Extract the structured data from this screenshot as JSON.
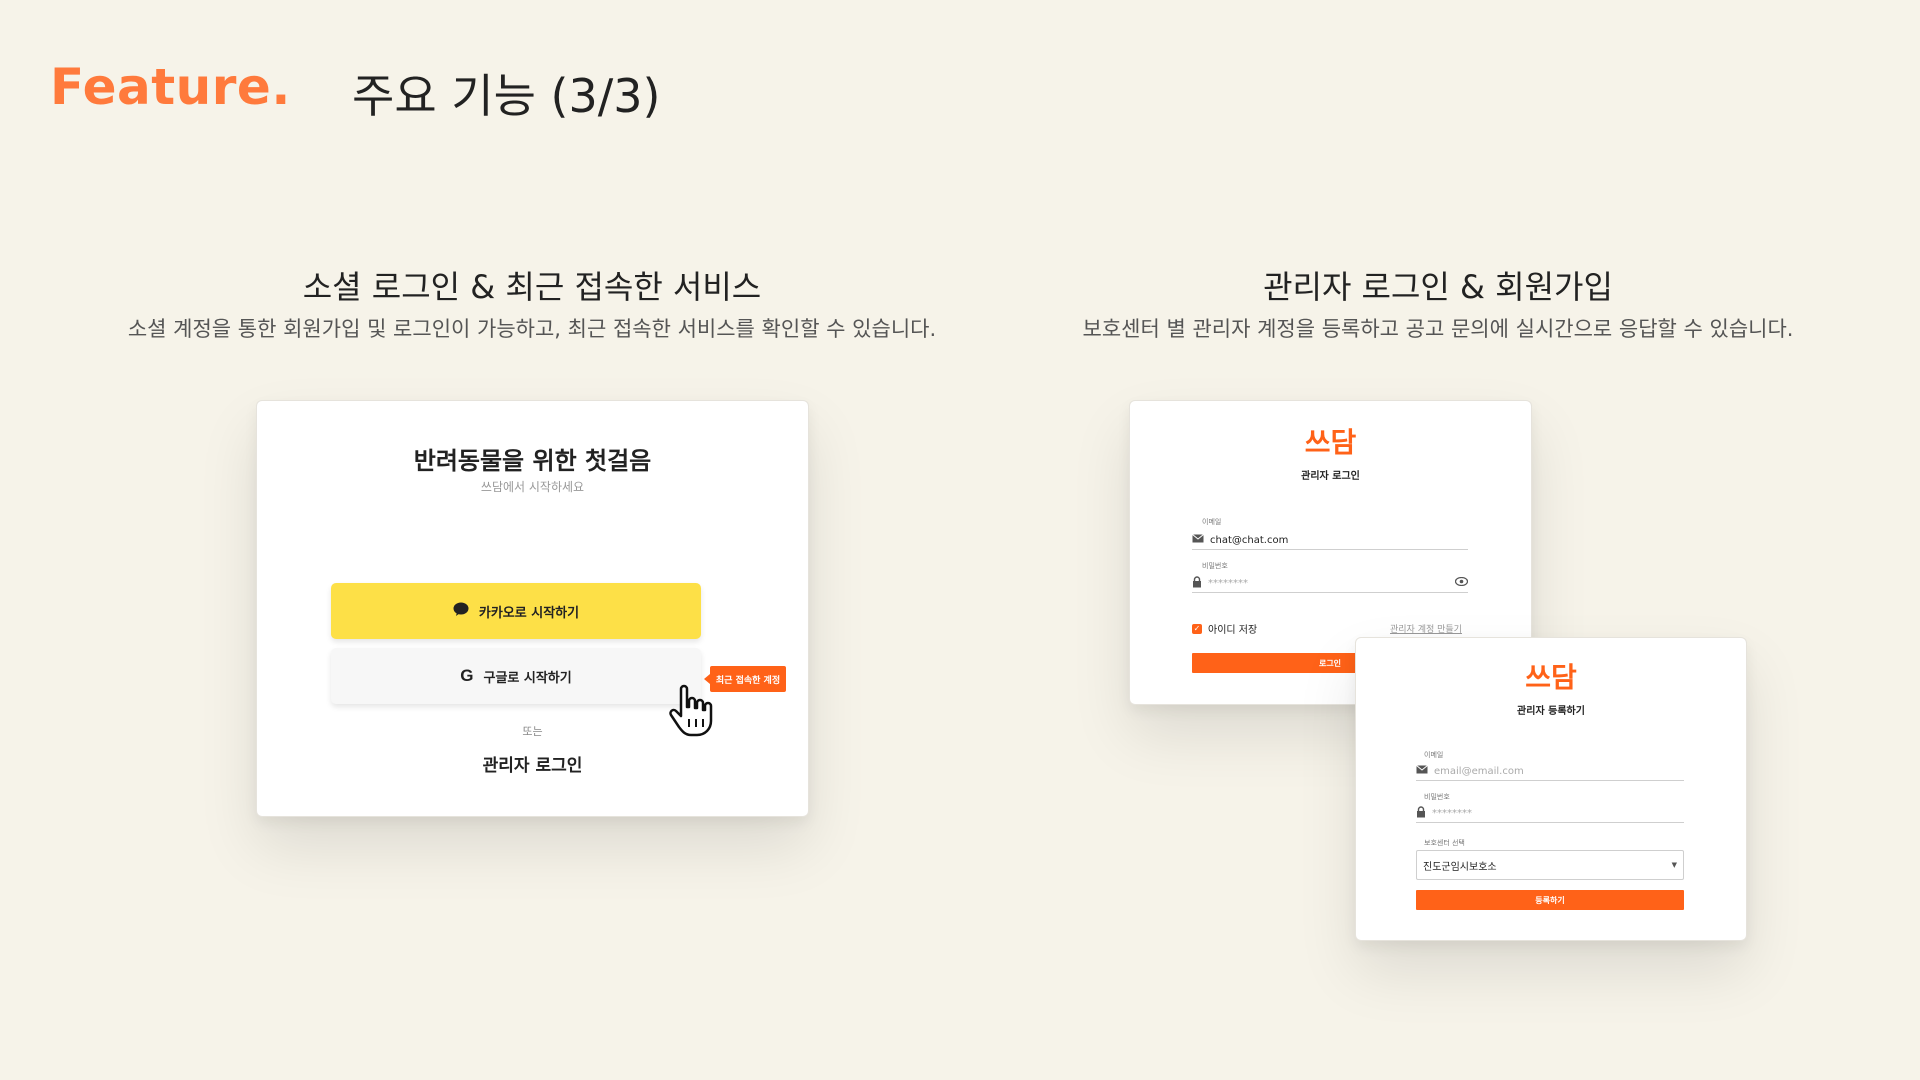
{
  "header": {
    "brand": "Feature.",
    "title": "주요 기능 (3/3)"
  },
  "left_section": {
    "title": "소셜 로그인 & 최근 접속한 서비스",
    "description": "소셜 계정을 통한 회원가입 및 로그인이 가능하고, 최근 접속한 서비스를 확인할 수 있습니다.",
    "card": {
      "title": "반려동물을 위한 첫걸음",
      "subtitle": "쓰담에서 시작하세요",
      "kakao_label": "카카오로 시작하기",
      "google_label": "구글로 시작하기",
      "recent_badge": "최근 접속한 계정",
      "or_text": "또는",
      "admin_login": "관리자 로그인"
    }
  },
  "right_section": {
    "title": "관리자 로그인 & 회원가입",
    "description": "보호센터 별 관리자 계정을 등록하고 공고 문의에 실시간으로 응답할 수 있습니다.",
    "login_card": {
      "logo": "쓰담",
      "heading": "관리자 로그인",
      "email_label": "이메일",
      "email_value": "chat@chat.com",
      "password_label": "비밀번호",
      "password_value": "********",
      "remember_label": "아이디 저장",
      "create_account_link": "관리자 계정 만들기",
      "login_button": "로그인"
    },
    "signup_card": {
      "logo": "쓰담",
      "heading": "관리자 등록하기",
      "email_label": "이메일",
      "email_placeholder": "email@email.com",
      "password_label": "비밀번호",
      "password_value": "********",
      "center_label": "보호센터 선택",
      "center_value": "진도군임시보호소",
      "submit_button": "등록하기"
    }
  },
  "colors": {
    "accent": "#ff7a3c",
    "button_orange": "#ff6218",
    "kakao_yellow": "#fde047",
    "background": "#f6f3e9"
  }
}
